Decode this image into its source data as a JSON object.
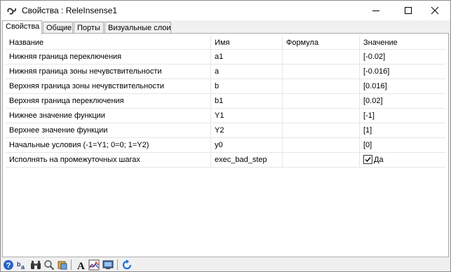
{
  "window": {
    "title": "Свойства : ReleInsense1"
  },
  "tabs": [
    {
      "label": "Свойства",
      "active": true
    },
    {
      "label": "Общие",
      "active": false
    },
    {
      "label": "Порты",
      "active": false
    },
    {
      "label": "Визуальные слои",
      "active": false
    }
  ],
  "table": {
    "columns": [
      "Название",
      "Имя",
      "Формула",
      "Значение"
    ],
    "rows": [
      {
        "name": "Нижняя граница переключения",
        "id": "a1",
        "formula": "",
        "value": "[-0.02]"
      },
      {
        "name": "Нижняя граница зоны нечувствительности",
        "id": "a",
        "formula": "",
        "value": "[-0.016]"
      },
      {
        "name": "Верхняя граница зоны нечувствительности",
        "id": "b",
        "formula": "",
        "value": "[0.016]"
      },
      {
        "name": "Верхняя граница переключения",
        "id": "b1",
        "formula": "",
        "value": "[0.02]"
      },
      {
        "name": "Нижнее значение функции",
        "id": "Y1",
        "formula": "",
        "value": "[-1]"
      },
      {
        "name": "Верхнее значение функции",
        "id": "Y2",
        "formula": "",
        "value": "[1]"
      },
      {
        "name": "Начальные условия (-1=Y1; 0=0; 1=Y2)",
        "id": "y0",
        "formula": "",
        "value": "[0]"
      },
      {
        "name": "Исполнять на промежуточных шагах",
        "id": "exec_bad_step",
        "formula": "",
        "value": "Да",
        "checkbox": true,
        "checked": true
      }
    ]
  },
  "toolbar": {
    "icons": [
      "help-icon",
      "sort-alpha-icon",
      "binoculars-icon",
      "magnifier-icon",
      "paint-icon",
      "font-icon",
      "chart-icon",
      "monitor-icon",
      "refresh-icon"
    ]
  },
  "colors": {
    "accent": "#1f6fd8",
    "grid_line": "#e6e6e6",
    "window_bg": "#f0f0f0"
  }
}
